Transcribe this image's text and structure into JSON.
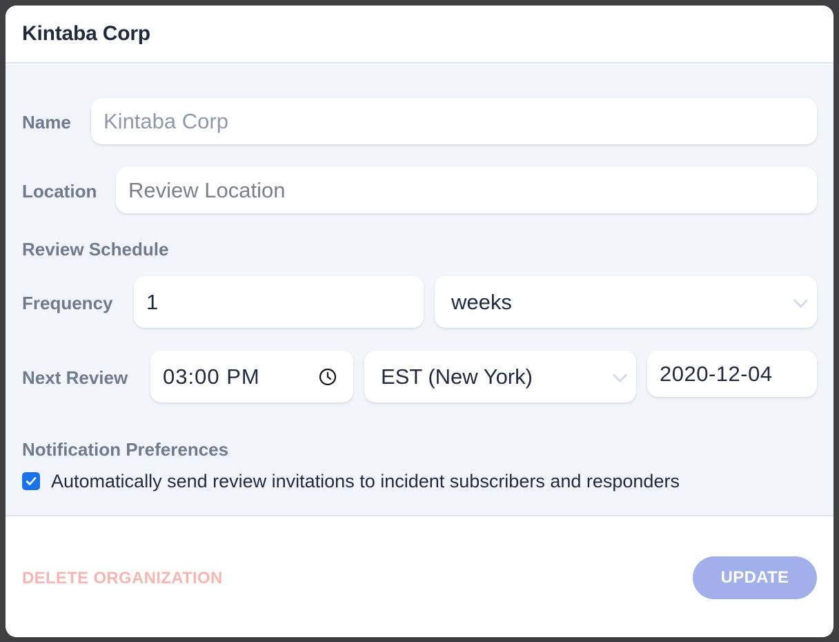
{
  "modal": {
    "title": "Kintaba Corp"
  },
  "form": {
    "name": {
      "label": "Name",
      "placeholder": "Kintaba Corp",
      "value": ""
    },
    "location": {
      "label": "Location",
      "placeholder": "Review Location",
      "value": ""
    },
    "review_schedule": {
      "heading": "Review Schedule",
      "frequency": {
        "label": "Frequency",
        "value": "1",
        "unit_selected": "weeks"
      },
      "next_review": {
        "label": "Next Review",
        "time": "03:00 PM",
        "timezone_selected": "EST (New York)",
        "date": "2020-12-04"
      }
    },
    "notifications": {
      "heading": "Notification Preferences",
      "auto_invite_label": "Automatically send review invitations to incident subscribers and responders",
      "auto_invite_checked": true
    }
  },
  "footer": {
    "delete_label": "DELETE ORGANIZATION",
    "update_label": "UPDATE"
  },
  "colors": {
    "primary_disabled": "#a1b0ea",
    "danger_disabled": "#f4b7b4",
    "checkbox_blue": "#1a73e8",
    "body_bg": "#f2f6fc"
  },
  "icons": {
    "clock": "clock-icon",
    "select_chevron": "chevron-down-icon",
    "checkbox": "checkmark-icon"
  }
}
